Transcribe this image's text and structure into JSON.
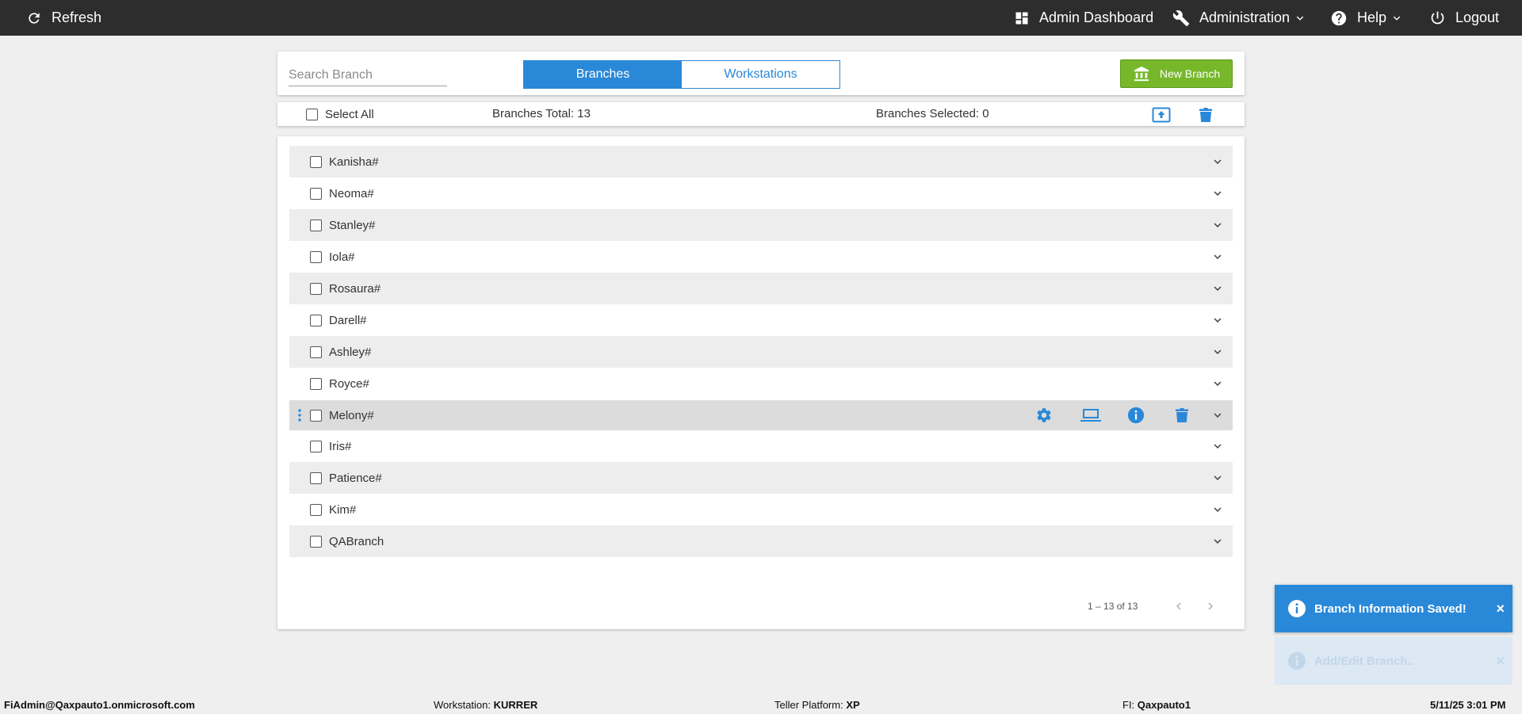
{
  "topbar": {
    "refresh_label": "Refresh",
    "admin_dashboard_label": "Admin Dashboard",
    "administration_label": "Administration",
    "help_label": "Help",
    "logout_label": "Logout"
  },
  "toolbar": {
    "search_placeholder": "Search Branch",
    "tabs": [
      {
        "label": "Branches",
        "active": true
      },
      {
        "label": "Workstations",
        "active": false
      }
    ],
    "new_branch_label": "New Branch"
  },
  "summary": {
    "select_all_label": "Select All",
    "total_text": "Branches Total: 13",
    "selected_text": "Branches Selected: 0"
  },
  "branches": [
    {
      "name": "Kanisha#"
    },
    {
      "name": "Neoma#"
    },
    {
      "name": "Stanley#"
    },
    {
      "name": "Iola#"
    },
    {
      "name": "Rosaura#"
    },
    {
      "name": "Darell#"
    },
    {
      "name": "Ashley#"
    },
    {
      "name": "Royce#"
    },
    {
      "name": "Melony#"
    },
    {
      "name": "Iris#"
    },
    {
      "name": "Patience#"
    },
    {
      "name": "Kim#"
    },
    {
      "name": "QABranch"
    }
  ],
  "pagination": {
    "range_text": "1 – 13 of 13"
  },
  "toasts": [
    {
      "message": "Branch Information Saved!",
      "close": "×"
    },
    {
      "message": "Add/Edit Branch..",
      "close": "×"
    }
  ],
  "footer": {
    "user": "FiAdmin@Qaxpauto1.onmicrosoft.com",
    "workstation_label": "Workstation:",
    "workstation_value": "KURRER",
    "platform_label": "Teller Platform:",
    "platform_value": "XP",
    "fi_label": "FI:",
    "fi_value": "Qaxpauto1",
    "datetime": "5/11/25 3:01 PM"
  },
  "colors": {
    "accent": "#2a88d8",
    "topbar": "#2d2d2d",
    "new_branch": "#76b82a",
    "background": "#efefef"
  }
}
